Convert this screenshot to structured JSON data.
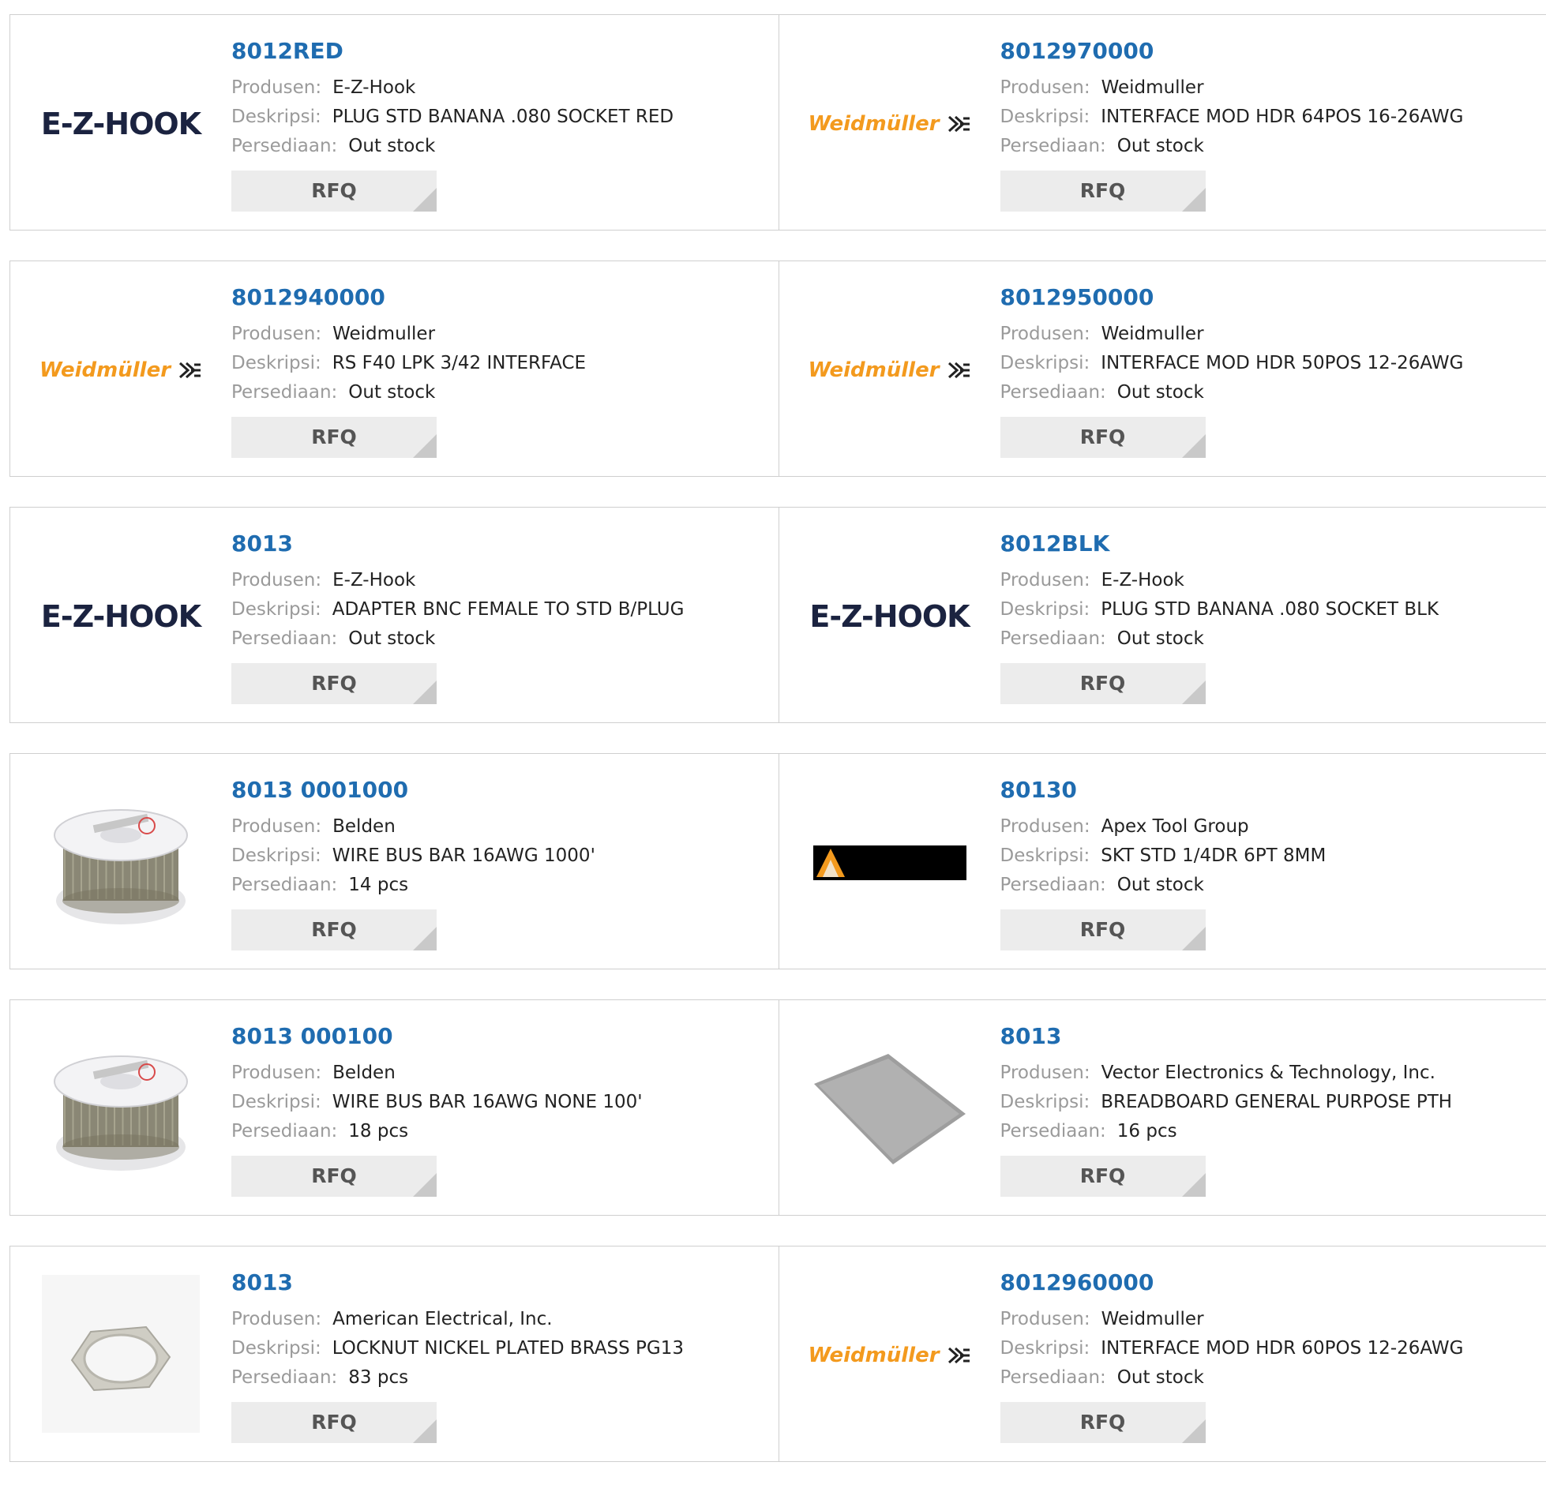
{
  "labels": {
    "manufacturer": "Produsen:",
    "description": "Deskripsi:",
    "stock": "Persediaan:",
    "rfq": "RFQ"
  },
  "colors": {
    "link": "#1f6cb0",
    "label": "#9a9a9a",
    "rfq_bg": "#ececec",
    "weidmuller_orange": "#f39a1e"
  },
  "rows": [
    [
      {
        "part": "8012RED",
        "manufacturer": "E-Z-Hook",
        "description": "PLUG STD BANANA .080 SOCKET RED",
        "stock": "Out stock",
        "image": "ezhook-logo"
      },
      {
        "part": "8012970000",
        "manufacturer": "Weidmuller",
        "description": "INTERFACE MOD HDR 64POS 16-26AWG",
        "stock": "Out stock",
        "image": "weidmuller-logo"
      }
    ],
    [
      {
        "part": "8012940000",
        "manufacturer": "Weidmuller",
        "description": "RS F40 LPK 3/42 INTERFACE",
        "stock": "Out stock",
        "image": "weidmuller-logo"
      },
      {
        "part": "8012950000",
        "manufacturer": "Weidmuller",
        "description": "INTERFACE MOD HDR 50POS 12-26AWG",
        "stock": "Out stock",
        "image": "weidmuller-logo"
      }
    ],
    [
      {
        "part": "8013",
        "manufacturer": "E-Z-Hook",
        "description": "ADAPTER BNC FEMALE TO STD B/PLUG",
        "stock": "Out stock",
        "image": "ezhook-logo"
      },
      {
        "part": "8012BLK",
        "manufacturer": "E-Z-Hook",
        "description": "PLUG STD BANANA .080 SOCKET BLK",
        "stock": "Out stock",
        "image": "ezhook-logo"
      }
    ],
    [
      {
        "part": "8013 0001000",
        "manufacturer": "Belden",
        "description": "WIRE BUS BAR 16AWG 1000'",
        "stock": "14 pcs",
        "image": "wire-spool-photo"
      },
      {
        "part": "80130",
        "manufacturer": "Apex Tool Group",
        "description": "SKT STD 1/4DR 6PT 8MM",
        "stock": "Out stock",
        "image": "apex-logo"
      }
    ],
    [
      {
        "part": "8013 000100",
        "manufacturer": "Belden",
        "description": "WIRE BUS BAR 16AWG NONE 100'",
        "stock": "18 pcs",
        "image": "wire-spool-photo"
      },
      {
        "part": "8013",
        "manufacturer": "Vector Electronics & Technology, Inc.",
        "description": "BREADBOARD GENERAL PURPOSE PTH",
        "stock": "16 pcs",
        "image": "breadboard-photo"
      }
    ],
    [
      {
        "part": "8013",
        "manufacturer": "American Electrical, Inc.",
        "description": "LOCKNUT NICKEL PLATED BRASS PG13",
        "stock": "83 pcs",
        "image": "locknut-photo"
      },
      {
        "part": "8012960000",
        "manufacturer": "Weidmuller",
        "description": "INTERFACE MOD HDR 60POS 12-26AWG",
        "stock": "Out stock",
        "image": "weidmuller-logo"
      }
    ]
  ],
  "logo_text": {
    "ezhook": "E-Z-HOOK",
    "weidmuller": "Weidmüller"
  }
}
